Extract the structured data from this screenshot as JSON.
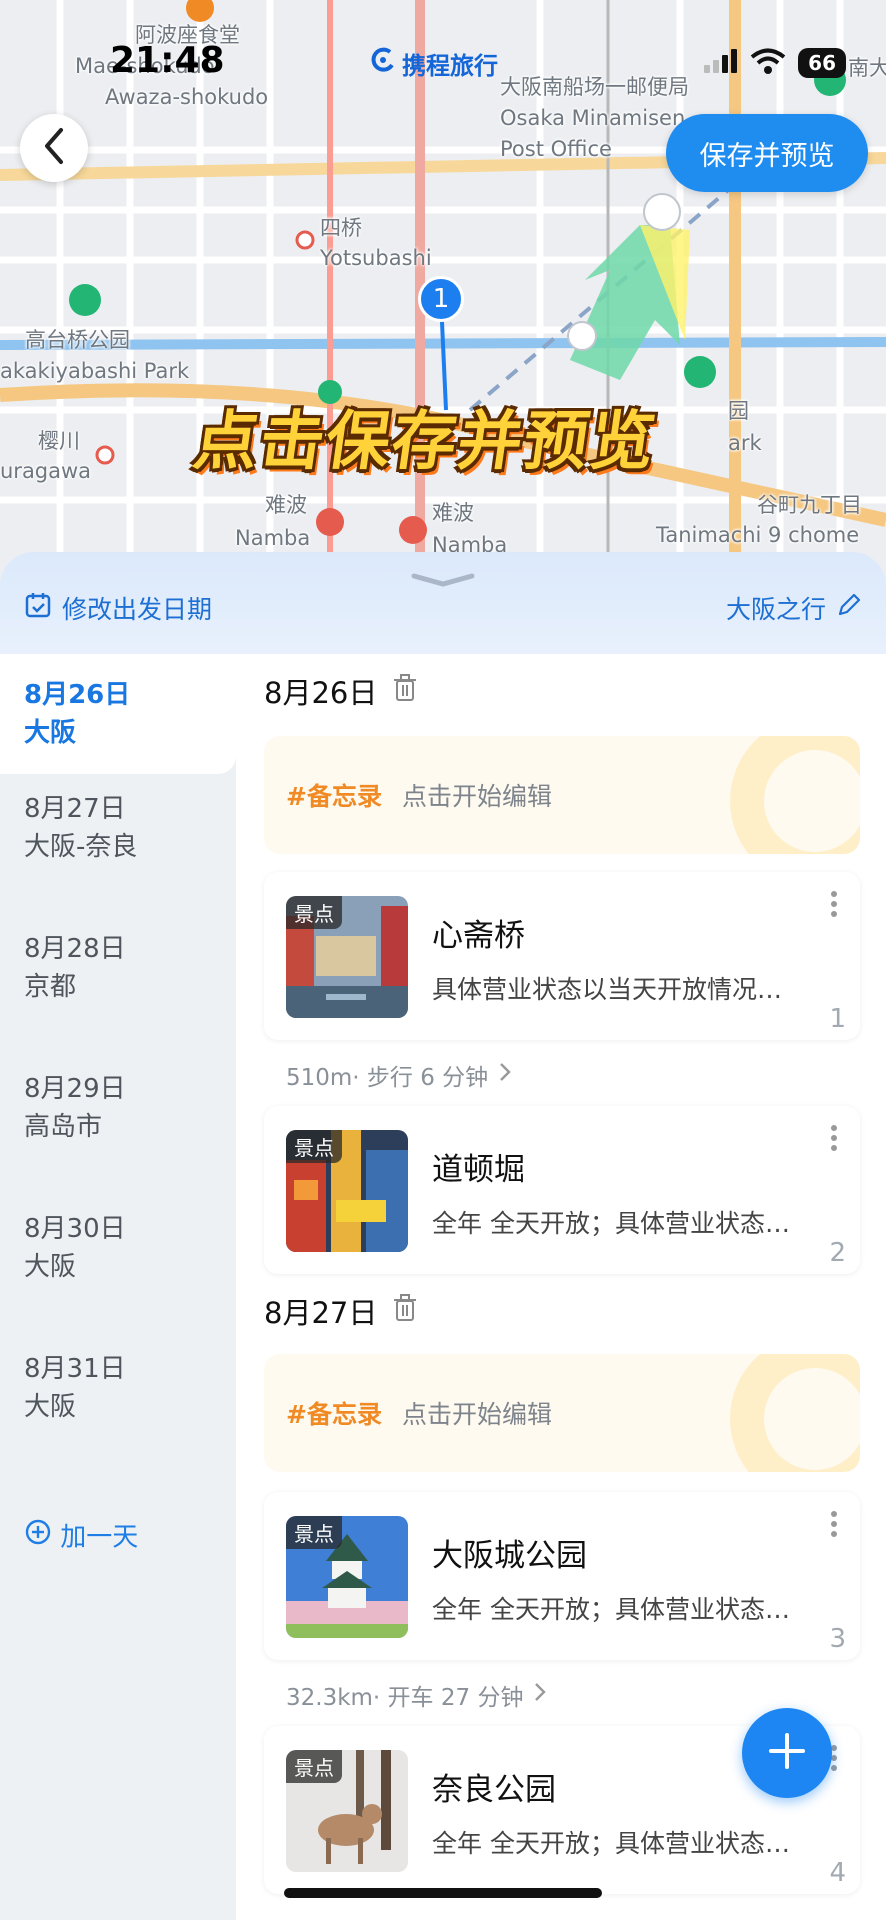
{
  "status_bar": {
    "time": "21:48",
    "app_name": "携程旅行",
    "battery": "66"
  },
  "map": {
    "labels": [
      {
        "text": "阿波座食堂"
      },
      {
        "text": "Mae-shokudo"
      },
      {
        "text": "Awaza-shokudo"
      },
      {
        "text": "大阪南船场一邮便局"
      },
      {
        "text": "Osaka Minamisen"
      },
      {
        "text": "Post Office"
      },
      {
        "text": "四桥"
      },
      {
        "text": "Yotsubashi"
      },
      {
        "text": "高台桥公园"
      },
      {
        "text": "akakiyabashi Park"
      },
      {
        "text": "樱川"
      },
      {
        "text": "uragawa"
      },
      {
        "text": "难波"
      },
      {
        "text": "Namba"
      },
      {
        "text": "难波"
      },
      {
        "text": "Namba"
      },
      {
        "text": "谷町九丁目"
      },
      {
        "text": "Tanimachi 9 chome"
      },
      {
        "text": "园"
      },
      {
        "text": "ark"
      },
      {
        "text": "南大"
      }
    ],
    "route_marker": "1",
    "save_preview_button": "保存并预览",
    "overlay_caption": "点击保存并预览"
  },
  "sheet": {
    "edit_date_label": "修改出发日期",
    "trip_name": "大阪之行",
    "days": [
      {
        "date": "8月26日",
        "city": "大阪",
        "active": true
      },
      {
        "date": "8月27日",
        "city": "大阪-奈良",
        "active": false
      },
      {
        "date": "8月28日",
        "city": "京都",
        "active": false
      },
      {
        "date": "8月29日",
        "city": "高岛市",
        "active": false
      },
      {
        "date": "8月30日",
        "city": "大阪",
        "active": false
      },
      {
        "date": "8月31日",
        "city": "大阪",
        "active": false
      }
    ],
    "add_day_label": "加一天",
    "sections": [
      {
        "date": "8月26日",
        "memo_tag": "#备忘录",
        "memo_hint": "点击开始编辑",
        "pois": [
          {
            "badge": "景点",
            "title": "心斋桥",
            "desc": "具体营业状态以当天开放情况…",
            "index": "1"
          },
          {
            "badge": "景点",
            "title": "道顿堀",
            "desc": "全年 全天开放；具体营业状态…",
            "index": "2"
          }
        ],
        "transit": "510m· 步行 6 分钟"
      },
      {
        "date": "8月27日",
        "memo_tag": "#备忘录",
        "memo_hint": "点击开始编辑",
        "pois": [
          {
            "badge": "景点",
            "title": "大阪城公园",
            "desc": "全年 全天开放；具体营业状态…",
            "index": "3"
          },
          {
            "badge": "景点",
            "title": "奈良公园",
            "desc": "全年 全天开放；具体营业状态…",
            "index": "4"
          }
        ],
        "transit": "32.3km· 开车 27 分钟"
      }
    ]
  },
  "colors": {
    "accent": "#1f8cf0",
    "memo_tag": "#f08a24",
    "caption": "#ffd23a"
  }
}
